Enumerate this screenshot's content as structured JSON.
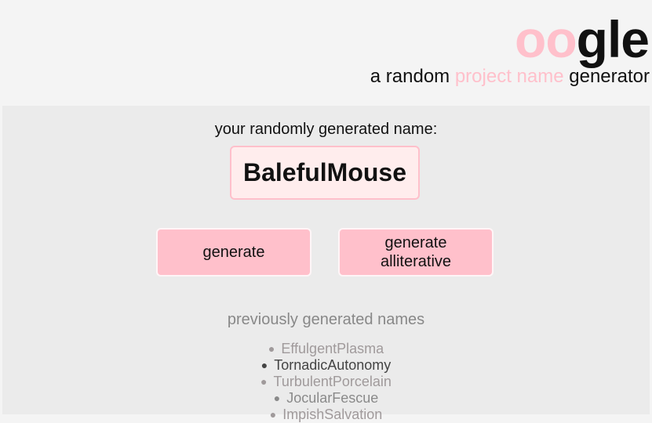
{
  "header": {
    "logo_part1": "oo",
    "logo_part2": "gle",
    "tagline_part1": "a random",
    "tagline_part2": "project name",
    "tagline_part3": "generator"
  },
  "main": {
    "prompt": "your randomly generated name:",
    "generated_name": "BalefulMouse",
    "generate_button": "generate",
    "generate_alliterative_button": "generate alliterative",
    "previous_title": "previously generated names",
    "previous_names": [
      "EffulgentPlasma",
      "TornadicAutonomy",
      "TurbulentPorcelain",
      "JocularFescue",
      "ImpishSalvation"
    ]
  },
  "colors": {
    "accent_pink": "#ffc0cb",
    "name_box_bg": "#ffeded",
    "main_bg": "#ebebeb",
    "page_bg": "#f4f4f4"
  }
}
